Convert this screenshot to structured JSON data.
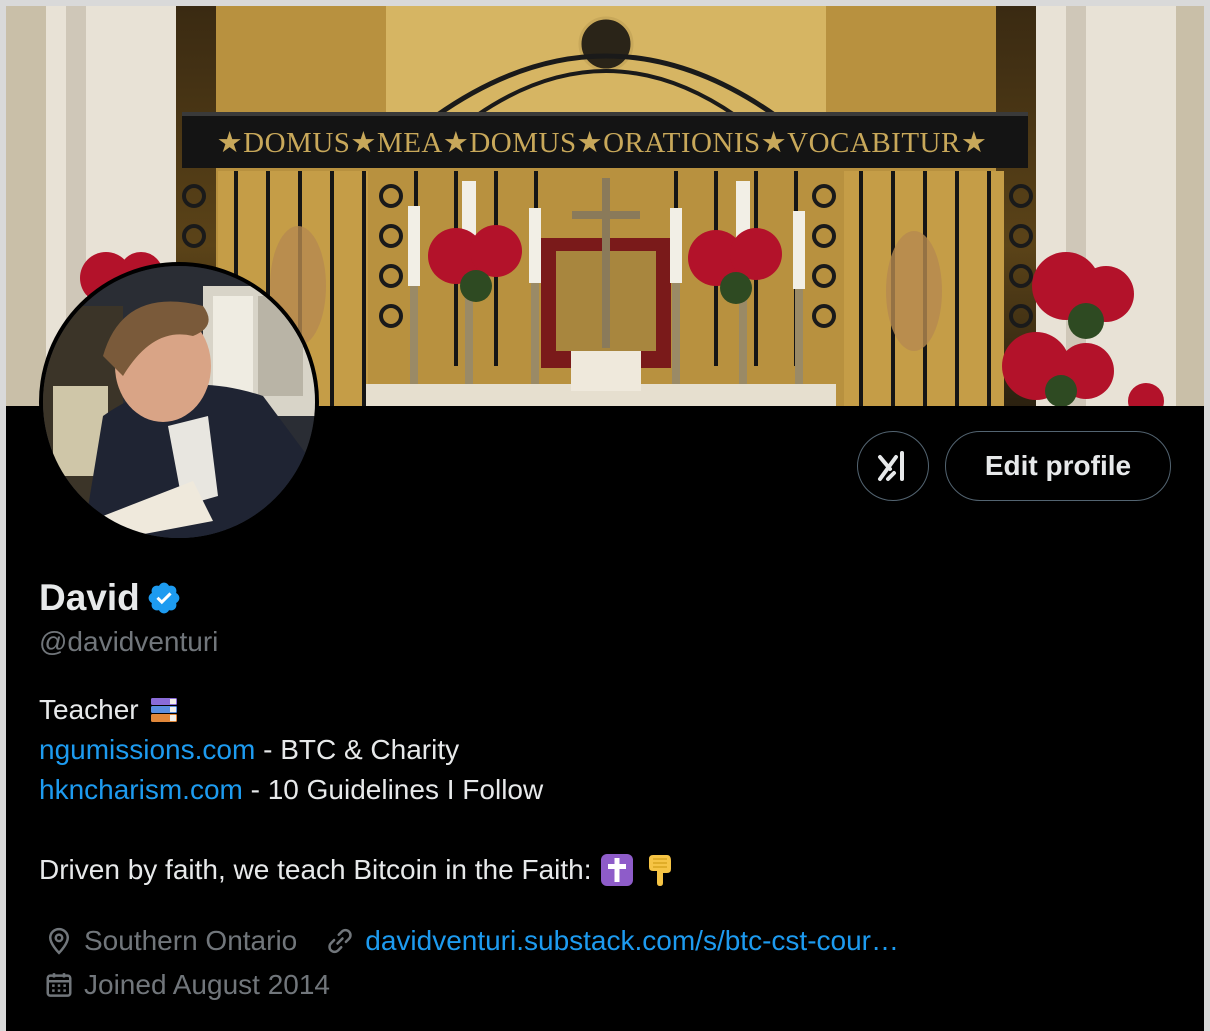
{
  "banner": {
    "inscription": "★DOMUS★MEA★DOMUS★ORATIONIS★VOCABITUR★"
  },
  "actions": {
    "grok_icon": "grok-icon",
    "edit_label": "Edit profile"
  },
  "profile": {
    "name": "David",
    "verified_icon": "verified-badge-icon",
    "handle": "@davidventuri"
  },
  "bio": {
    "line1_text": "Teacher",
    "line1_emoji": "books-emoji",
    "line2_link": "ngumissions.com",
    "line2_text": " - BTC & Charity",
    "line3_link": "hkncharism.com",
    "line3_text": " - 10 Guidelines I Follow",
    "line4_text": "Driven by faith, we teach Bitcoin in the Faith:",
    "line4_emojis": [
      "latin-cross-emoji",
      "pointing-down-emoji"
    ]
  },
  "meta": {
    "location_icon": "location-pin-icon",
    "location": "Southern Ontario",
    "link_icon": "link-icon",
    "website": "davidventuri.substack.com/s/btc-cst-cour…",
    "joined_icon": "calendar-icon",
    "joined": "Joined August 2014"
  },
  "colors": {
    "background": "#000000",
    "text_primary": "#e7e9ea",
    "text_secondary": "#71767b",
    "link": "#1d9bf0",
    "verified": "#1d9bf0",
    "button_border": "#536471"
  }
}
